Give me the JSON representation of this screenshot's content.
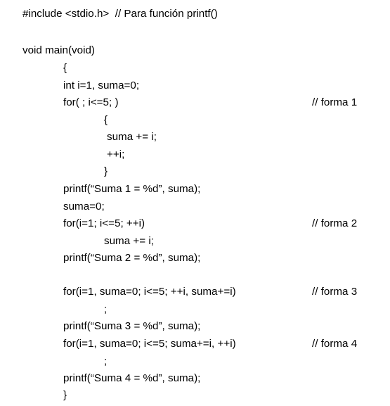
{
  "code": {
    "include": "#include <stdio.h>  // Para función printf()",
    "main_sig": "void main(void)",
    "open_brace": "{",
    "decl": "int i=1, suma=0;",
    "for1": "for( ; i<=5; )",
    "comment1": "// forma 1",
    "inner_open": "{",
    "sum_stmt": "suma += i;",
    "inc_stmt": "++i;",
    "inner_close": "}",
    "print1": "printf(“Suma 1 = %d”, suma);",
    "reset": "suma=0;",
    "for2": "for(i=1; i<=5; ++i)",
    "comment2": "// forma 2",
    "for2_body": "suma += i;",
    "print2": "printf(“Suma 2 = %d”, suma);",
    "for3": "for(i=1, suma=0; i<=5; ++i, suma+=i)",
    "comment3": "// forma 3",
    "semi3": ";",
    "print3": "printf(“Suma 3 = %d”, suma);",
    "for4": "for(i=1, suma=0; i<=5; suma+=i, ++i)",
    "comment4": "// forma 4",
    "semi4": ";",
    "print4": "printf(“Suma 4 = %d”, suma);",
    "close_brace": "}"
  }
}
